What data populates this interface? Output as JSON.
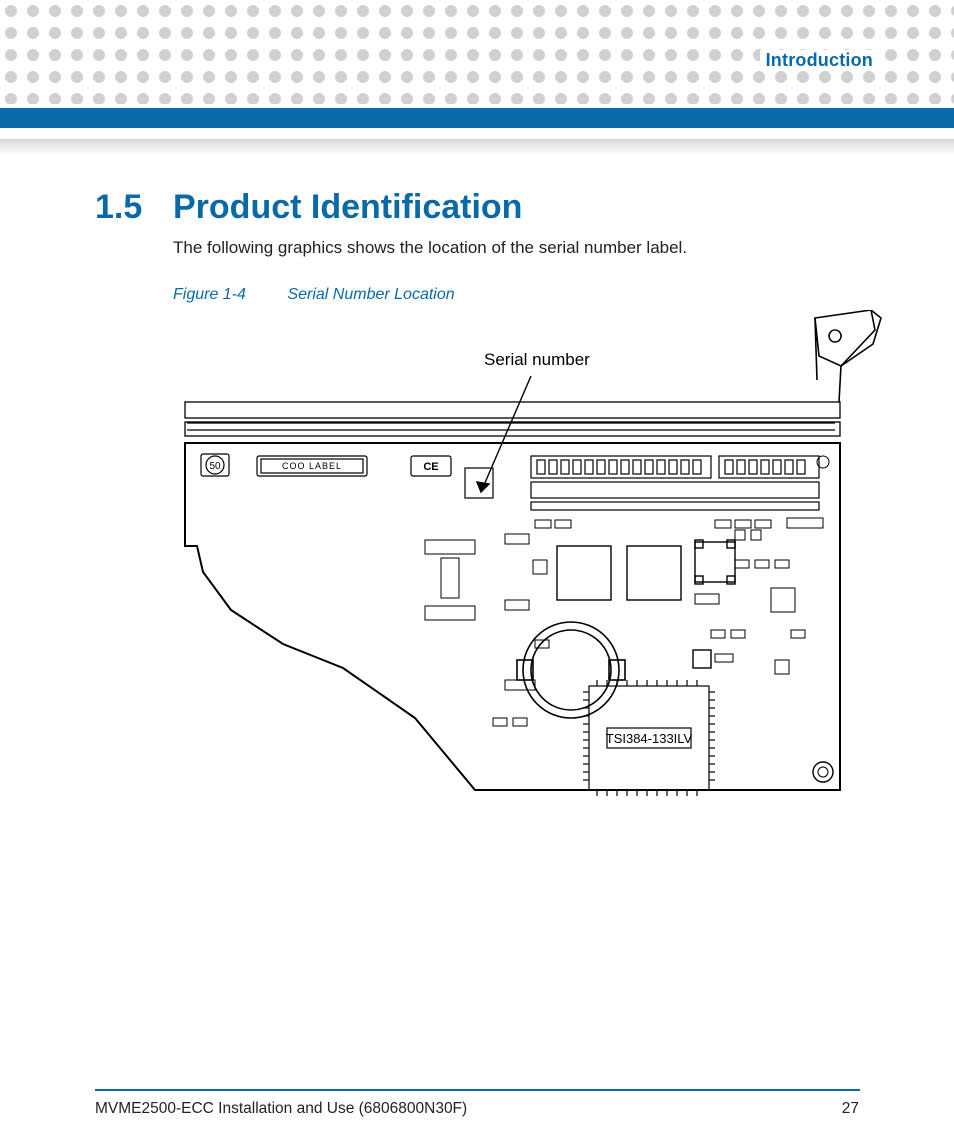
{
  "header": {
    "chapter_label": "Introduction"
  },
  "section": {
    "number": "1.5",
    "title": "Product Identification",
    "body": "The following graphics shows the location of the serial number label."
  },
  "figure": {
    "label_prefix": "Figure 1-4",
    "caption": "Serial Number Location",
    "callout": "Serial number",
    "board_text": {
      "coo_label": "COO  LABEL",
      "ce_mark": "CE",
      "fifty": "50",
      "chip_label": "TSI384-133ILV"
    }
  },
  "footer": {
    "doc": "MVME2500-ECC Installation and Use (6806800N30F)",
    "page": "27"
  }
}
